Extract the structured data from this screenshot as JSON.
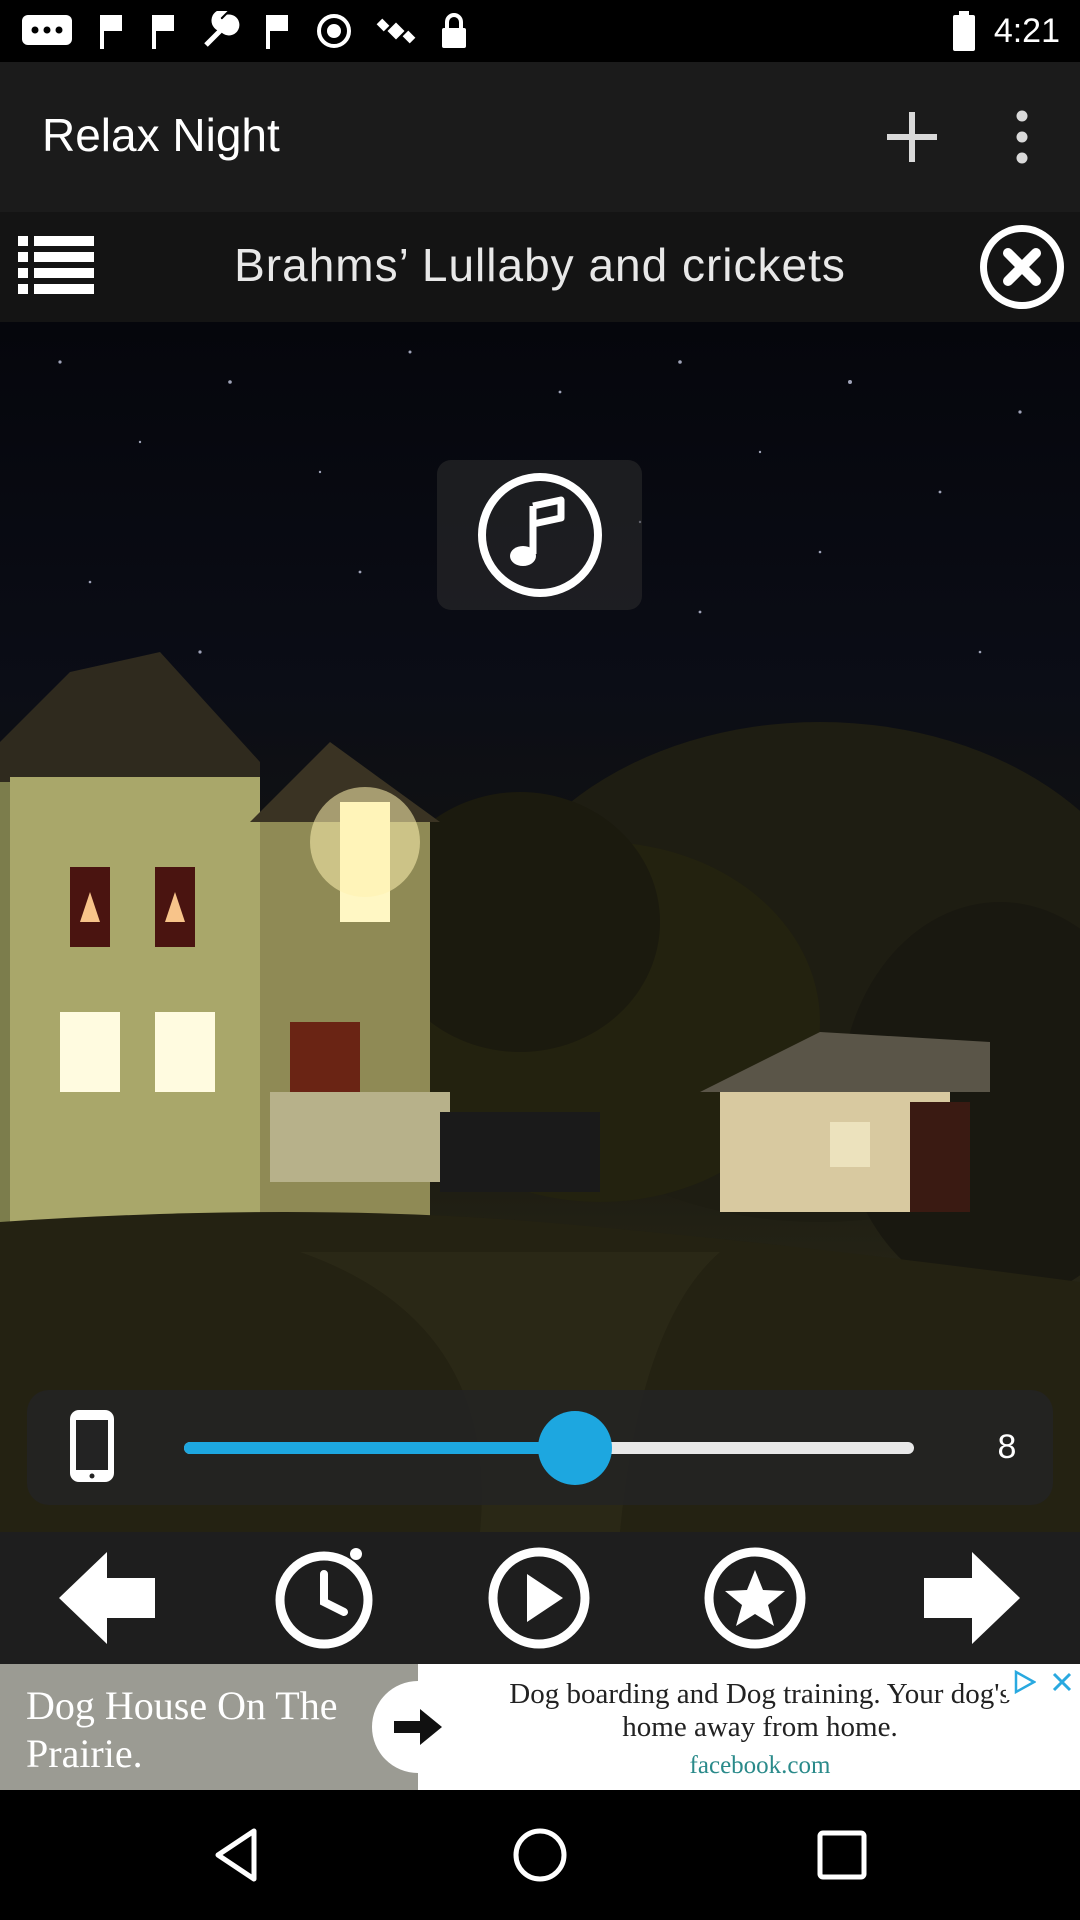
{
  "status_bar": {
    "time": "4:21",
    "icons": [
      "message-icon",
      "flag-icon",
      "flag-icon",
      "wrench-icon",
      "flag-icon",
      "vpn-icon",
      "satellite-icon",
      "lock-icon",
      "battery-icon"
    ]
  },
  "app_bar": {
    "title": "Relax Night",
    "add_icon": "plus-icon",
    "menu_icon": "more-vert-icon"
  },
  "track": {
    "title": "Brahms’ Lullaby and crickets",
    "list_icon": "list-icon",
    "close_icon": "close-circle-icon"
  },
  "scene": {
    "music_icon": "music-note-icon"
  },
  "volume": {
    "device_icon": "phone-icon",
    "level_fraction": 0.535,
    "value": "8",
    "accent_color": "#1da7e0"
  },
  "controls": {
    "items": [
      "previous-icon",
      "timer-icon",
      "play-icon",
      "favorite-icon",
      "next-icon"
    ]
  },
  "ad": {
    "left_text": "Dog House On The Prairie.",
    "right_text": "Dog boarding and Dog training. Your dog's home away from home.",
    "url": "facebook.com"
  },
  "nav_bar": {
    "items": [
      "back-icon",
      "home-icon",
      "recents-icon"
    ]
  }
}
